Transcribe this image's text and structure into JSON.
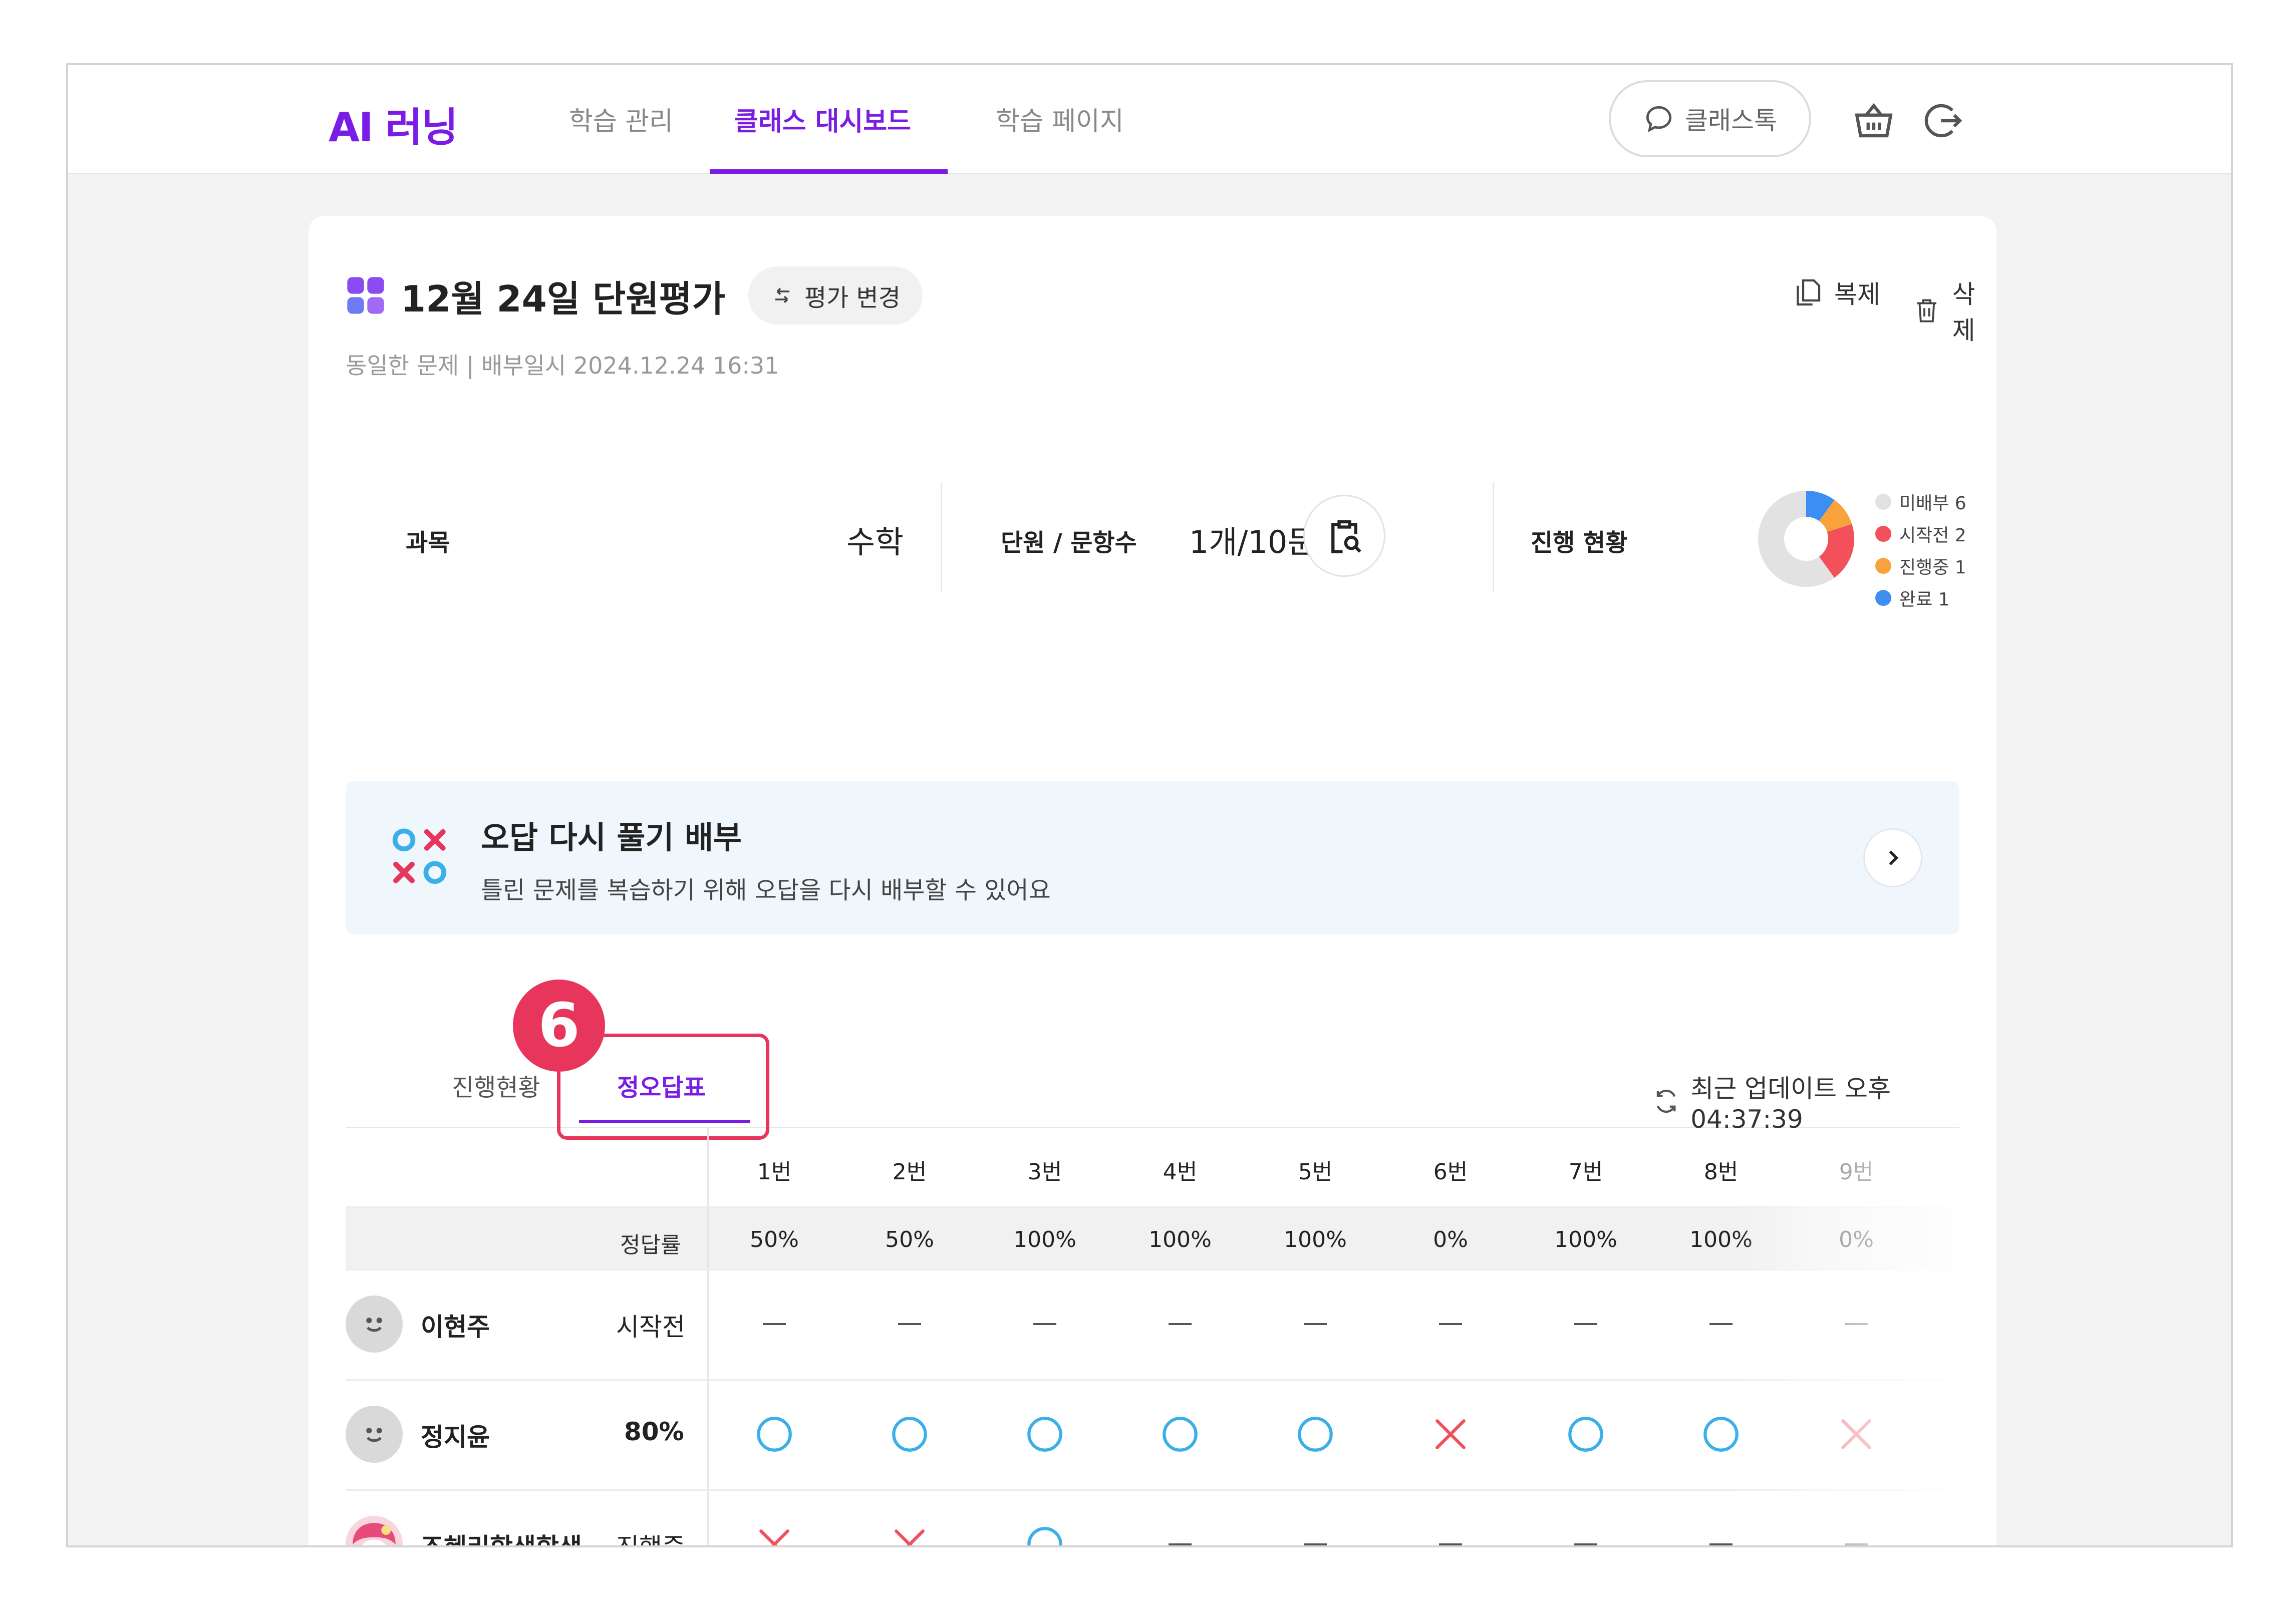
{
  "header": {
    "logo": "AI 러닝",
    "nav": [
      "학습 관리",
      "클래스 대시보드",
      "학습 페이지"
    ],
    "talk_label": "클래스톡",
    "icons": [
      "chat-icon",
      "basket-icon",
      "logout-icon"
    ]
  },
  "assessment": {
    "title": "12월 24일 단원평가",
    "change_label": "평가 변경",
    "meta": "동일한 문제 | 배부일시 2024.12.24 16:31",
    "copy_label": "복제",
    "delete_label": "삭제"
  },
  "info": {
    "subject_label": "과목",
    "subject_value": "수학",
    "unit_label": "단원 / 문항수",
    "unit_value": "1개/10문항",
    "progress_label": "진행 현황",
    "legend": [
      {
        "label": "미배부 6",
        "count": 6,
        "color": "#e2e2e2"
      },
      {
        "label": "시작전 2",
        "count": 2,
        "color": "#f2505a"
      },
      {
        "label": "진행중 1",
        "count": 1,
        "color": "#f7a23b"
      },
      {
        "label": "완료 1",
        "count": 1,
        "color": "#3d8ef2"
      }
    ]
  },
  "banner": {
    "title": "오답 다시 풀기 배부",
    "subtitle": "틀린 문제를 복습하기 위해 오답을 다시 배부할 수 있어요"
  },
  "tabs": {
    "items": [
      "진행현황",
      "정오답표"
    ],
    "active": 1,
    "step_badge": "6",
    "update_label": "최근 업데이트 오후 04:37:39"
  },
  "table": {
    "questions": [
      "1번",
      "2번",
      "3번",
      "4번",
      "5번",
      "6번",
      "7번",
      "8번",
      "9번"
    ],
    "rate_label": "정답률",
    "rates": [
      "50%",
      "50%",
      "100%",
      "100%",
      "100%",
      "0%",
      "100%",
      "100%",
      "0%"
    ],
    "students": [
      {
        "name": "이현주",
        "status": "시작전",
        "answers": [
          "-",
          "-",
          "-",
          "-",
          "-",
          "-",
          "-",
          "-",
          "-"
        ]
      },
      {
        "name": "정지윤",
        "status": "80%",
        "answers": [
          "O",
          "O",
          "O",
          "O",
          "O",
          "X",
          "O",
          "O",
          "X"
        ]
      },
      {
        "name": "조혜리학생학생",
        "status": "진행중",
        "answers": [
          "X",
          "X",
          "O",
          "-",
          "-",
          "-",
          "-",
          "-",
          "-"
        ]
      }
    ]
  },
  "colors": {
    "accent": "#7a1ce6",
    "highlight": "#e8355c",
    "correct": "#3bb0e8",
    "wrong": "#f0505a"
  }
}
